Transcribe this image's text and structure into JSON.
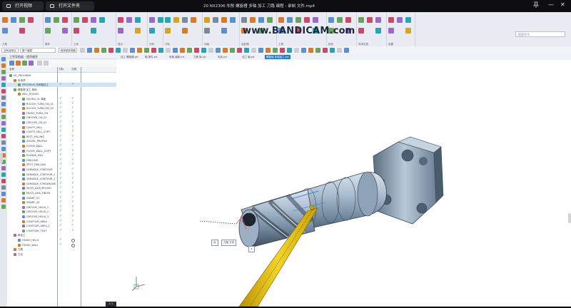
{
  "player": {
    "btn_open": "打开视频",
    "btn_folder": "打开文件夹",
    "file_title": "20 NX2306 车削 螺旋槽 多轴 加工 刀路 编程 - 录制 文件.mp4",
    "pin_icon": "pin-icon",
    "min_label": "—",
    "close_label": "✕"
  },
  "watermark": {
    "text": "www.BANDICAM.com"
  },
  "ribbon": {
    "groups": [
      {
        "label": "刀具"
      },
      {
        "label": "操作"
      },
      {
        "label": "工序"
      },
      {
        "label": "显示"
      },
      {
        "label": "分析"
      },
      {
        "label": "刀轨"
      },
      {
        "label": "动画"
      },
      {
        "label": "后处理"
      },
      {
        "label": "工具"
      },
      {
        "label": "检查"
      },
      {
        "label": "车间文档"
      },
      {
        "label": "设置"
      }
    ],
    "search_placeholder": "搜索命令"
  },
  "toolbar": {
    "filter_combo": "没有选择过滤器",
    "scope_combo": "整个装配",
    "view_combo": "程序顺序视图"
  },
  "navigator": {
    "title": "工序导航器 - 程序顺序",
    "col_name": "名称",
    "col_path": "刀轨",
    "col_tool": "刀具",
    "rows": [
      {
        "text": "NC_PROGRAM",
        "indent": 0,
        "path": "",
        "tool": ""
      },
      {
        "text": "未用项",
        "indent": 1,
        "path": "",
        "tool": ""
      },
      {
        "text": "PROGRAM_车削粗加工",
        "indent": 2,
        "path": "✓",
        "tool": "✓",
        "selected": true
      },
      {
        "text": "螺旋槽 加工 程序",
        "indent": 1,
        "path": "",
        "tool": ""
      },
      {
        "text": "MILL_ROUGH",
        "indent": 2,
        "path": "",
        "tool": ""
      },
      {
        "text": "FACING_01 端面",
        "indent": 3,
        "path": "✓",
        "tool": "✓"
      },
      {
        "text": "ROUGH_TURN_OD_01",
        "indent": 3,
        "path": "✓",
        "tool": "✓"
      },
      {
        "text": "ROUGH_TURN_OD_02",
        "indent": 3,
        "path": "✓",
        "tool": "✓"
      },
      {
        "text": "FINISH_TURN_OD",
        "indent": 3,
        "path": "✓",
        "tool": "✓"
      },
      {
        "text": "GROOVE_OD_01",
        "indent": 3,
        "path": "✓",
        "tool": "✓"
      },
      {
        "text": "GROOVE_OD_02",
        "indent": 3,
        "path": "✓",
        "tool": "✓"
      },
      {
        "text": "CAVITY_MILL",
        "indent": 3,
        "path": "✓",
        "tool": "✓"
      },
      {
        "text": "CAVITY_MILL_COPY",
        "indent": 3,
        "path": "✓",
        "tool": "✓"
      },
      {
        "text": "REST_MILLING",
        "indent": 3,
        "path": "✓",
        "tool": "✓"
      },
      {
        "text": "ZLEVEL_PROFILE",
        "indent": 3,
        "path": "✓",
        "tool": "✓"
      },
      {
        "text": "FLOOR_WALL",
        "indent": 3,
        "path": "✓",
        "tool": "✓"
      },
      {
        "text": "FLOOR_WALL_COPY",
        "indent": 3,
        "path": "✓",
        "tool": "✓"
      },
      {
        "text": "PLANAR_MILL",
        "indent": 3,
        "path": "✓",
        "tool": "✓"
      },
      {
        "text": "DRILLING",
        "indent": 3,
        "path": "✓",
        "tool": "✓"
      },
      {
        "text": "SPOT_DRILLING",
        "indent": 3,
        "path": "✓",
        "tool": "✓"
      },
      {
        "text": "VARIABLE_CONTOUR",
        "indent": 3,
        "path": "✓",
        "tool": "✓"
      },
      {
        "text": "VARIABLE_CONTOUR_1",
        "indent": 3,
        "path": "✓",
        "tool": "✓"
      },
      {
        "text": "VARIABLE_CONTOUR_2",
        "indent": 3,
        "path": "✓",
        "tool": "✓"
      },
      {
        "text": "VARIABLE_STREAMLINE",
        "indent": 3,
        "path": "✓",
        "tool": "✓"
      },
      {
        "text": "MULTI_AXIS_ROUGH",
        "indent": 3,
        "path": "✓",
        "tool": "✓"
      },
      {
        "text": "MULTI_AXIS_FINISH",
        "indent": 3,
        "path": "✓",
        "tool": "✓"
      },
      {
        "text": "SWARF_01",
        "indent": 3,
        "path": "✓",
        "tool": "✓"
      },
      {
        "text": "SWARF_02",
        "indent": 3,
        "path": "✓",
        "tool": "✓"
      },
      {
        "text": "GROOVE_HELIX_1",
        "indent": 3,
        "path": "✓",
        "tool": "✓"
      },
      {
        "text": "GROOVE_HELIX_2",
        "indent": 3,
        "path": "✓",
        "tool": "✓"
      },
      {
        "text": "GROOVE_HELIX_3",
        "indent": 3,
        "path": "✓",
        "tool": "✓"
      },
      {
        "text": "CONTOUR_AREA",
        "indent": 3,
        "path": "✓",
        "tool": "✓"
      },
      {
        "text": "CONTOUR_AREA_1",
        "indent": 3,
        "path": "✓",
        "tool": "✓"
      },
      {
        "text": "CONTOUR_TEXT",
        "indent": 3,
        "path": "✓",
        "tool": "✓"
      },
      {
        "text": "精加工",
        "indent": 1,
        "path": "",
        "tool": ""
      },
      {
        "text": "FINISH_HELIX",
        "indent": 2,
        "path": "✓",
        "tool": "○"
      },
      {
        "text": "FINISH_WALL",
        "indent": 2,
        "path": "✓",
        "tool": "○"
      },
      {
        "text": "刀具",
        "indent": 1,
        "path": "",
        "tool": ""
      },
      {
        "text": "方法",
        "indent": 1,
        "path": "",
        "tool": ""
      }
    ]
  },
  "tabs": [
    {
      "label": "加工 螺旋槽.prt"
    },
    {
      "label": "轴 零件.prt"
    },
    {
      "label": "夹具 装配.prt"
    },
    {
      "label": "刀具 库.prt"
    },
    {
      "label": "毛坯.prt"
    },
    {
      "label": "法兰 轴.prt"
    },
    {
      "label": "螺旋轴 多轴加工.prt",
      "active": true
    }
  ],
  "viewport": {
    "callout_1": "点",
    "callout_2": "刀轴 方向",
    "callout_3": "✕",
    "zoom": "1:1"
  },
  "colors": {
    "ribbon_bg": "#e9edf3",
    "active_tab": "#1f7ad1",
    "part_metal": "#9fb3c8",
    "tool_yellow": "#e6c21a",
    "check_green": "#2a9b3e"
  }
}
